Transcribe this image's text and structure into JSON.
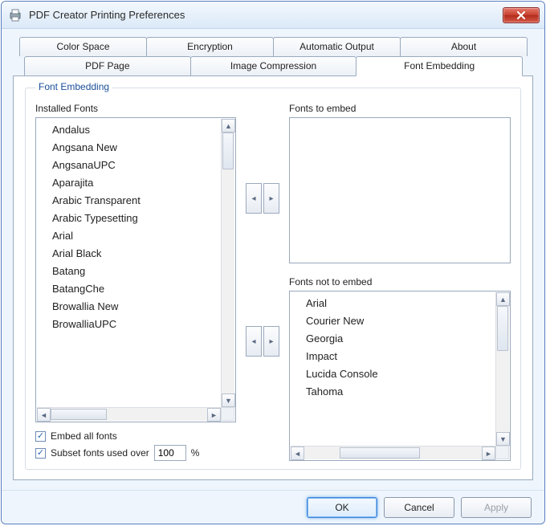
{
  "window": {
    "title": "PDF Creator Printing Preferences"
  },
  "tabs_row1": [
    {
      "label": "Color Space"
    },
    {
      "label": "Encryption"
    },
    {
      "label": "Automatic Output"
    },
    {
      "label": "About"
    }
  ],
  "tabs_row2": [
    {
      "label": "PDF Page"
    },
    {
      "label": "Image Compression"
    },
    {
      "label": "Font Embedding",
      "active": true
    }
  ],
  "group": {
    "legend": "Font Embedding"
  },
  "installed": {
    "label": "Installed Fonts",
    "items": [
      "Andalus",
      "Angsana New",
      "AngsanaUPC",
      "Aparajita",
      "Arabic Transparent",
      "Arabic Typesetting",
      "Arial",
      "Arial Black",
      "Batang",
      "BatangChe",
      "Browallia New",
      "BrowalliaUPC"
    ]
  },
  "embed": {
    "label": "Fonts to embed",
    "items": []
  },
  "notembed": {
    "label": "Fonts not to embed",
    "items": [
      "Arial",
      "Courier New",
      "Georgia",
      "Impact",
      "Lucida Console",
      "Tahoma"
    ]
  },
  "checks": {
    "embed_all": {
      "label": "Embed all fonts",
      "checked": true
    },
    "subset": {
      "label": "Subset fonts used over",
      "checked": true,
      "value": "100",
      "suffix": "%"
    }
  },
  "buttons": {
    "ok": "OK",
    "cancel": "Cancel",
    "apply": "Apply"
  }
}
